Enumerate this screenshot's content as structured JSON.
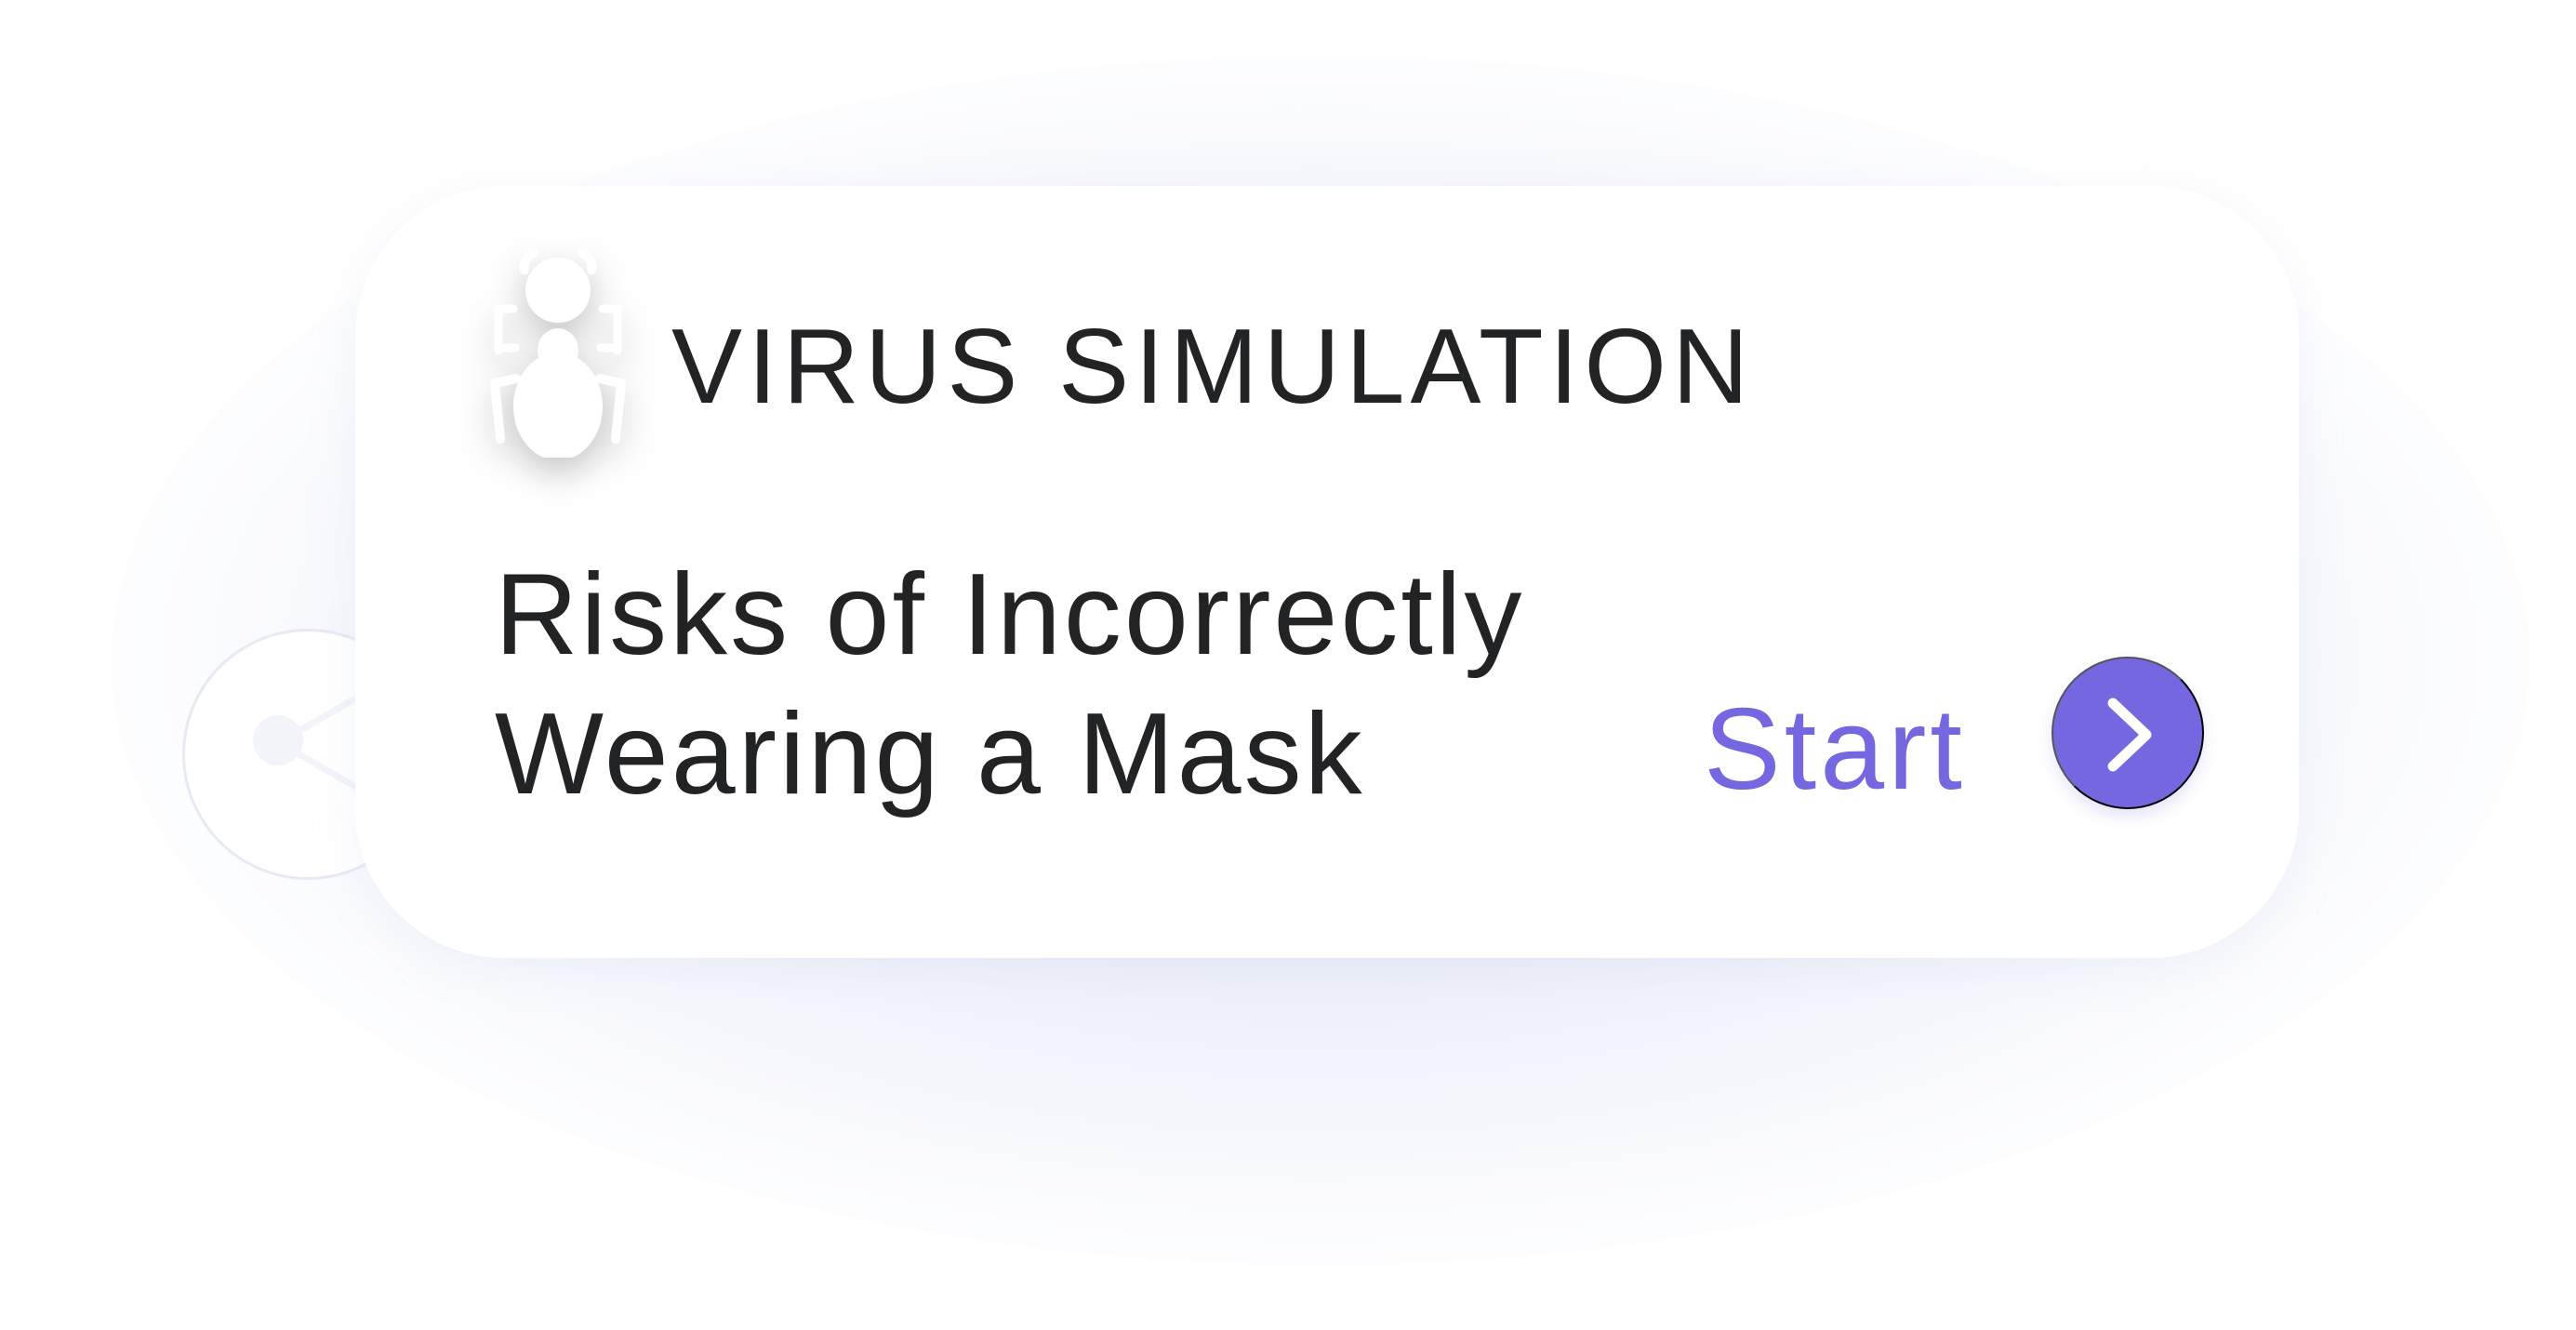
{
  "card": {
    "eyebrow": "VIRUS SIMULATION",
    "title_lines": [
      "Risks of Incorrectly",
      "Wearing a Mask"
    ],
    "cta_label": "Start"
  },
  "icons": {
    "left": "bug-icon",
    "button": "chevron-right-icon"
  },
  "colors": {
    "text": "#222325",
    "accent": "#7467e0",
    "card": "#ffffff"
  }
}
